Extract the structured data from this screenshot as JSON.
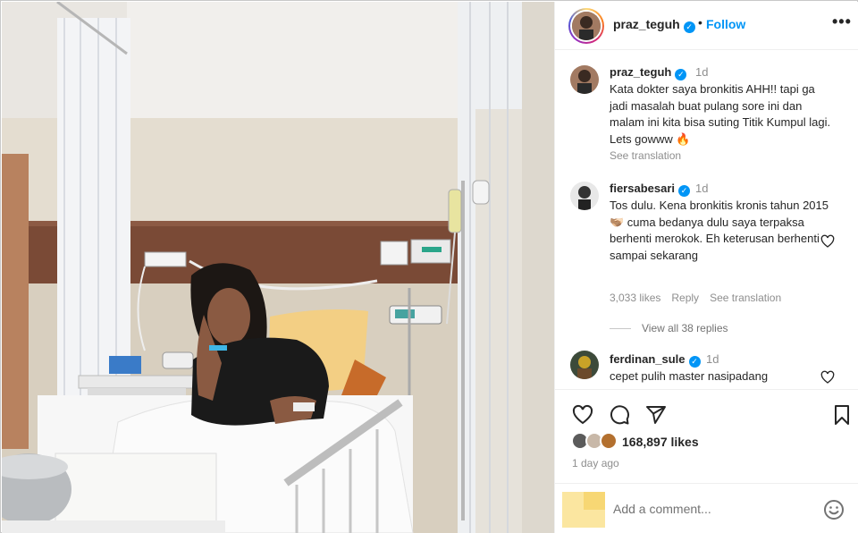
{
  "post": {
    "username": "praz_teguh",
    "follow_label": "Follow",
    "separator": "•",
    "more_label": "•••",
    "caption": {
      "username": "praz_teguh",
      "time": "1d",
      "text": "Kata dokter saya bronkitis AHH!! tapi ga jadi masalah buat pulang sore ini dan malam ini kita bisa suting Titik Kumpul lagi. Lets gowww 🔥",
      "see_translation": "See translation"
    },
    "comments": [
      {
        "username": "fiersabesari",
        "time": "1d",
        "text": "Tos dulu. Kena bronkitis kronis tahun 2015 🫱🏽‍🫲🏻 cuma bedanya dulu saya terpaksa berhenti merokok. Eh keterusan berhenti sampai sekarang",
        "likes": "3,033 likes",
        "reply": "Reply",
        "see_translation": "See translation",
        "view_replies": "View all 38 replies"
      },
      {
        "username": "ferdinan_sule",
        "time": "1d",
        "text": "cepet pulih master nasipadang"
      }
    ],
    "likes_count": "168,897 likes",
    "posted_ago": "1 day ago",
    "add_comment_placeholder": "Add a comment..."
  },
  "icons": {
    "verified": "verified-badge-icon",
    "like": "heart-icon",
    "comment": "comment-icon",
    "share": "share-icon",
    "save": "bookmark-icon",
    "emoji": "emoji-icon"
  },
  "colors": {
    "accent": "#0095f6",
    "text": "#262626",
    "muted": "#8e8e8e",
    "border": "#efefef"
  }
}
